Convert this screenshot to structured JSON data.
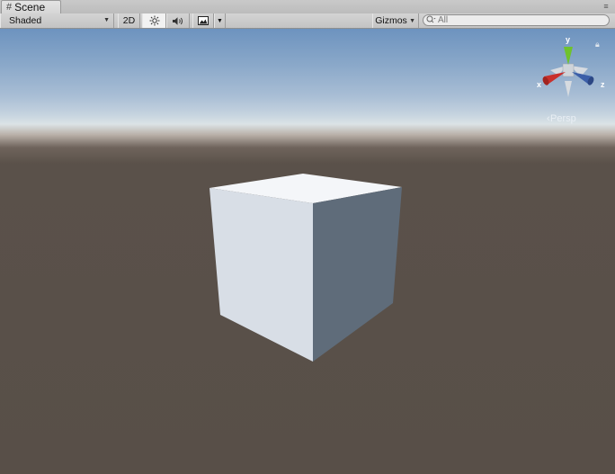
{
  "tab": {
    "label": "Scene",
    "icon": "grid-icon"
  },
  "toolbar": {
    "draw_mode": "Shaded",
    "mode_2d": "2D",
    "lighting_icon": "sun-icon",
    "audio_icon": "speaker-icon",
    "effects_icon": "image-icon",
    "gizmos": "Gizmos",
    "search_placeholder": "All"
  },
  "viewport": {
    "projection": "Persp",
    "axes": {
      "x": "x",
      "y": "y",
      "z": "z"
    }
  },
  "colors": {
    "axis_x": "#c9302c",
    "axis_y": "#6fc22c",
    "axis_z": "#3c5fa8",
    "cube_top": "#f4f6f9",
    "cube_left": "#d8dee6",
    "cube_right": "#5f6c7a",
    "ground": "#584f48"
  }
}
